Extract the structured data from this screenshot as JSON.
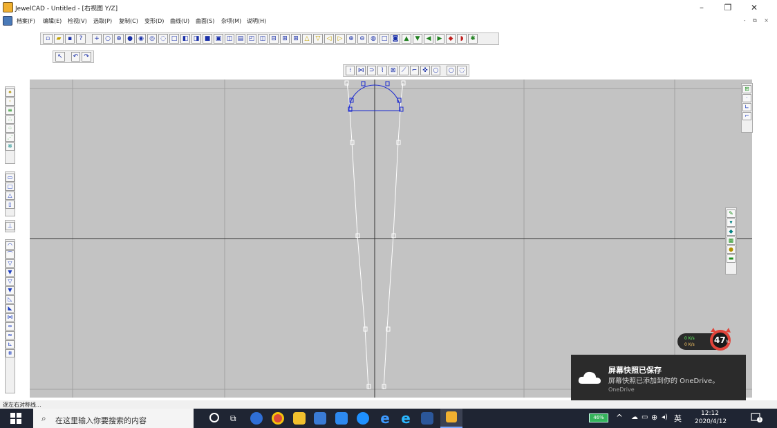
{
  "window": {
    "title": "JewelCAD - Untitled - [右视图 Y/Z]"
  },
  "menu": [
    "档案(F)",
    "编辑(E)",
    "检视(V)",
    "选取(P)",
    "复制(C)",
    "变形(D)",
    "曲线(U)",
    "曲面(S)",
    "杂项(M)",
    "说明(H)"
  ],
  "window_controls": {
    "minimize": "–",
    "restore": "❐",
    "close": "✕"
  },
  "mdi_controls": "- ⧉ ×",
  "status": {
    "text": "逐左右对称线..."
  },
  "taskbar": {
    "search_placeholder": "在这里输入你要搜索的内容",
    "battery": "46%",
    "ime": "英",
    "time": "12:12",
    "date": "2020/4/12",
    "notifications_count": "1"
  },
  "notification": {
    "title": "屏幕快照已保存",
    "body": "屏幕快照已添加到你的 OneDrive。",
    "source": "OneDrive"
  },
  "speed_widget": {
    "upload": "0 K/s",
    "download": "0 K/s",
    "percent": "47",
    "percent_unit": "%"
  },
  "colors": {
    "viewport": "#c3c3c3",
    "curve_blue": "#1a28d0",
    "toast_bg": "#2b2b2b",
    "taskbar_bg": "#1f2533"
  }
}
